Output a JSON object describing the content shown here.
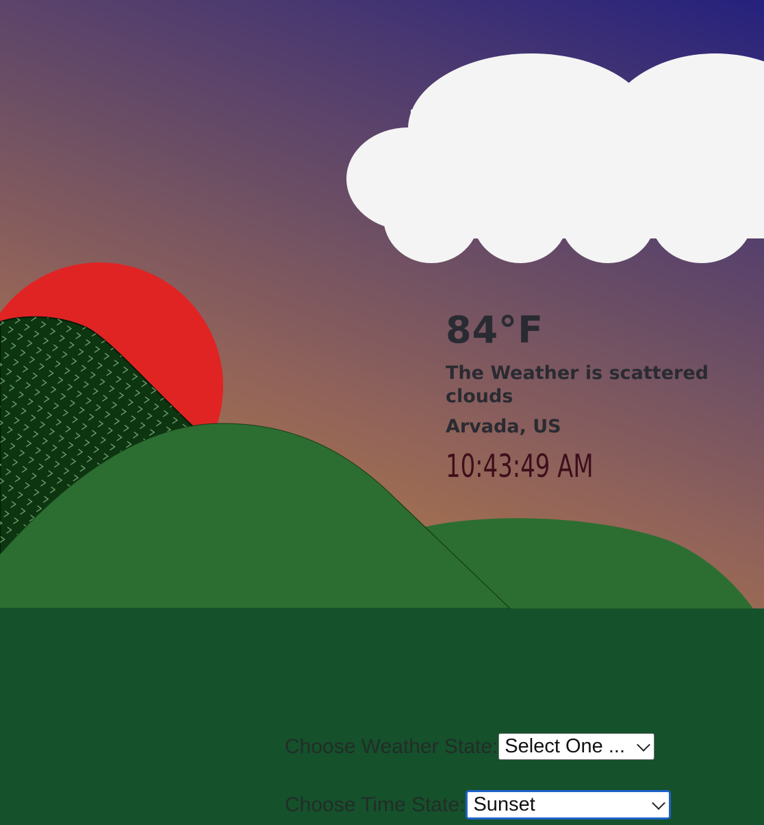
{
  "scene": {
    "sky_colors": [
      "#25217d",
      "#6d4f64",
      "#a8744c"
    ],
    "sun_color": "#e02424",
    "cloud_color": "#f4f4f4",
    "hill_color": "#2c6e31",
    "dark_hill_color": "#0c3510",
    "ground_color": "#15512b"
  },
  "weather": {
    "temperature": "84°F",
    "description": "The Weather is scattered clouds",
    "location": "Arvada, US",
    "time": "10:43:49 AM"
  },
  "controls": {
    "weather_label": "Choose Weather State:",
    "weather_selected": "Select One ...",
    "time_label": "Choose Time State:",
    "time_selected": "Sunset"
  }
}
